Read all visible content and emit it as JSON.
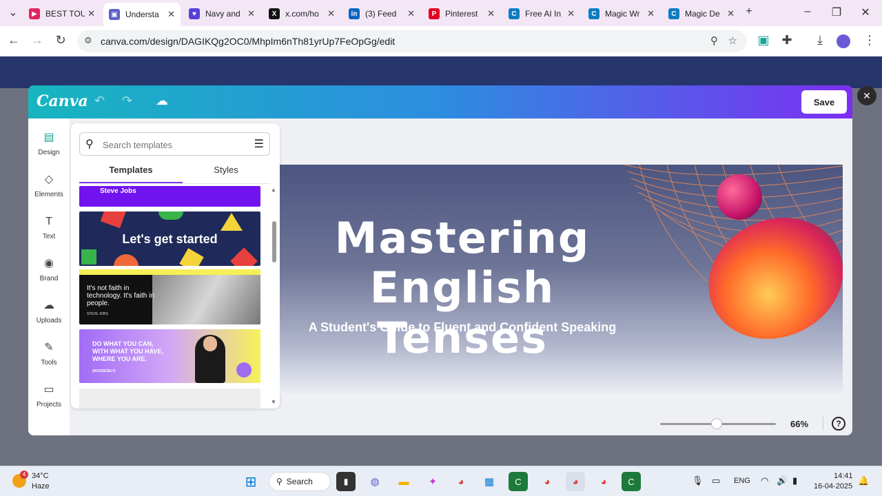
{
  "browser": {
    "tabs": [
      {
        "label": "BEST TOU",
        "color": "#e0245e",
        "glyph": "▶"
      },
      {
        "label": "Understa",
        "color": "#5b5fc7",
        "glyph": "▣",
        "active": true
      },
      {
        "label": "Navy and",
        "color": "#5940d8",
        "glyph": "♥"
      },
      {
        "label": "x.com/ho",
        "color": "#111111",
        "glyph": "X"
      },
      {
        "label": "(3) Feed",
        "color": "#0a66c2",
        "glyph": "in"
      },
      {
        "label": "Pinterest",
        "color": "#e60023",
        "glyph": "P"
      },
      {
        "label": "Free AI In",
        "color": "#0e7bc4",
        "glyph": "C"
      },
      {
        "label": "Magic Wr",
        "color": "#0e7bc4",
        "glyph": "C"
      },
      {
        "label": "Magic De",
        "color": "#0e7bc4",
        "glyph": "C"
      }
    ],
    "tab_close": "✕",
    "new_tab": "+",
    "url": "canva.com/design/DAGIKQg2OC0/MhpIm6nTh81yrUp7FeOpGg/edit"
  },
  "modal": {
    "logo": "Canva",
    "save_label": "Save",
    "close": "✕"
  },
  "rail": {
    "items": [
      {
        "label": "Design",
        "icon": "design-icon",
        "glyph": "▤",
        "active": true
      },
      {
        "label": "Elements",
        "icon": "elements-icon",
        "glyph": "◇"
      },
      {
        "label": "Text",
        "icon": "text-icon",
        "glyph": "T"
      },
      {
        "label": "Brand",
        "icon": "brand-icon",
        "glyph": "◉"
      },
      {
        "label": "Uploads",
        "icon": "uploads-icon",
        "glyph": "☁"
      },
      {
        "label": "Tools",
        "icon": "tools-icon",
        "glyph": "✎"
      },
      {
        "label": "Projects",
        "icon": "projects-icon",
        "glyph": "▭"
      }
    ]
  },
  "panel": {
    "search_placeholder": "Search templates",
    "tabs": [
      "Templates",
      "Styles"
    ],
    "templates": {
      "t1": "Steve Jobs",
      "t2": "Let's get started",
      "t3": "It's not faith in technology. It's faith in people.",
      "t3_sub": "STEVE JOBS",
      "t4": "DO WHAT YOU CAN, WITH WHAT YOU HAVE, WHERE YOU ARE.",
      "t4_sub": "(ROOSEVELT)"
    }
  },
  "design": {
    "title_line1": "Mastering",
    "title_line2": "English Tenses",
    "subtitle": "A Student's Guide to Fluent and Confident Speaking"
  },
  "zoom": {
    "label": "66%",
    "level": 0.66,
    "help": "?"
  },
  "taskbar": {
    "weather_badge": "4",
    "temperature": "34°C",
    "weather": "Haze",
    "search": "Search",
    "lang": "ENG",
    "time": "14:41",
    "date": "16-04-2025"
  }
}
